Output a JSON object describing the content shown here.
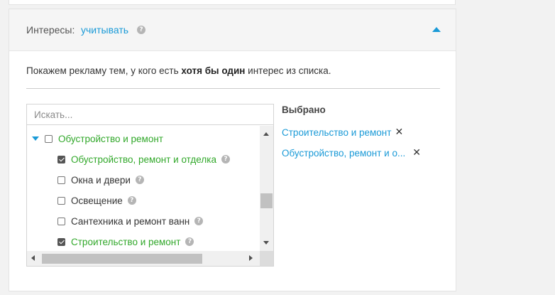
{
  "header": {
    "label": "Интересы:",
    "mode_link": "учитывать",
    "help": "?"
  },
  "description": {
    "prefix": "Покажем рекламу тем, у кого есть ",
    "emphasis": "хотя бы один",
    "suffix": " интерес из списка."
  },
  "search": {
    "placeholder": "Искать...",
    "value": ""
  },
  "tree": {
    "parent": {
      "label": "Обустройство и ремонт",
      "checked": false,
      "expanded": true
    },
    "children": [
      {
        "label": "Обустройство, ремонт и отделка",
        "checked": true
      },
      {
        "label": "Окна и двери",
        "checked": false
      },
      {
        "label": "Освещение",
        "checked": false
      },
      {
        "label": "Сантехника и ремонт ванн",
        "checked": false
      },
      {
        "label": "Строительство и ремонт",
        "checked": true
      }
    ]
  },
  "selected": {
    "title": "Выбрано",
    "items": [
      {
        "label": "Строительство и ремонт",
        "remove": "✕"
      },
      {
        "label": "Обустройство, ремонт и о...",
        "remove": "✕"
      }
    ]
  },
  "colors": {
    "accent": "#1a9ad7",
    "checked_green": "#31a82a"
  },
  "icons": {
    "collapse": "triangle-up",
    "tree_toggle": "triangle-down",
    "help": "question-circle",
    "remove": "cross"
  }
}
